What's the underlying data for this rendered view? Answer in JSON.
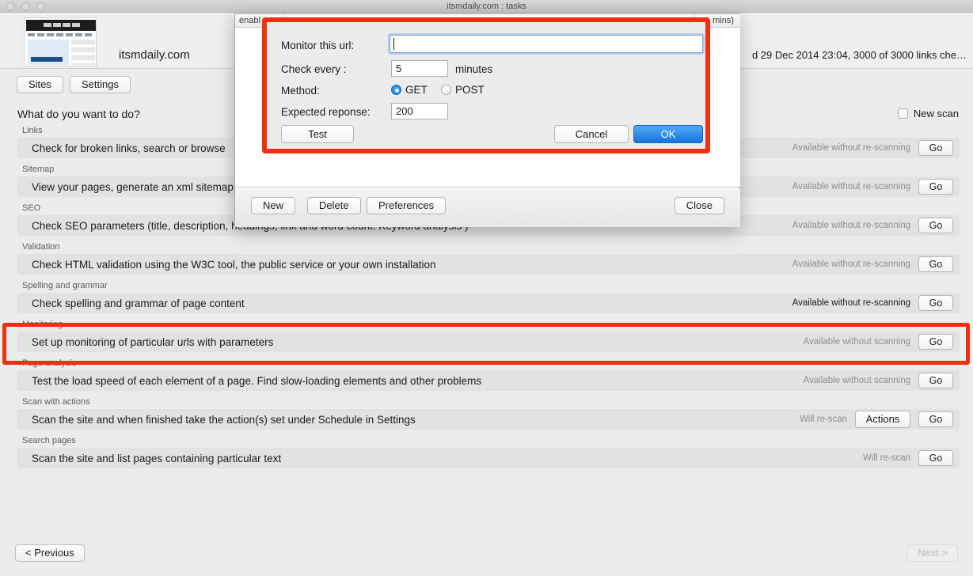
{
  "window": {
    "title": "itsmdaily.com : tasks",
    "traffic_lights": [
      "close",
      "minimize",
      "zoom"
    ]
  },
  "site_header": {
    "site_name": "itsmdaily.com",
    "scan_status": "d 29 Dec 2014 23:04, 3000 of 3000 links che…"
  },
  "tabs": [
    {
      "id": "sites",
      "label": "Sites"
    },
    {
      "id": "settings",
      "label": "Settings"
    }
  ],
  "main": {
    "question": "What do you want to do?",
    "new_scan": {
      "label": "New scan",
      "checked": false
    },
    "previous_button": "< Previous",
    "next_button": "Next >"
  },
  "tasks": [
    {
      "group": "Links",
      "description": "Check for broken links, search or browse",
      "availability": "Available without re-scanning",
      "availability_strong": false,
      "actions_label": null,
      "go_label": "Go"
    },
    {
      "group": "Sitemap",
      "description": "View your pages, generate an xml sitemap",
      "availability": "Available without re-scanning",
      "availability_strong": false,
      "actions_label": null,
      "go_label": "Go"
    },
    {
      "group": "SEO",
      "description": "Check SEO parameters (title, description, headings, link and word count. Keyword analysis )",
      "availability": "Available without re-scanning",
      "availability_strong": false,
      "actions_label": null,
      "go_label": "Go"
    },
    {
      "group": "Validation",
      "description": "Check HTML validation using the W3C tool, the public service or your own installation",
      "availability": "Available without re-scanning",
      "availability_strong": false,
      "actions_label": null,
      "go_label": "Go"
    },
    {
      "group": "Spelling and grammar",
      "description": "Check spelling and grammar of page content",
      "availability": "Available without re-scanning",
      "availability_strong": true,
      "actions_label": null,
      "go_label": "Go"
    },
    {
      "group": "Monitoring",
      "description": "Set up monitoring of particular urls with parameters",
      "availability": "Available without scanning",
      "availability_strong": false,
      "actions_label": null,
      "go_label": "Go",
      "highlighted": true
    },
    {
      "group": "Page analysis",
      "description": "Test the load speed of each element of a page. Find slow-loading elements and other problems",
      "availability": "Available without scanning",
      "availability_strong": false,
      "actions_label": null,
      "go_label": "Go"
    },
    {
      "group": "Scan with actions",
      "description": "Scan the site and when finished take the action(s) set under Schedule in Settings",
      "availability": "Will re-scan",
      "availability_strong": false,
      "actions_label": "Actions",
      "go_label": "Go"
    },
    {
      "group": "Search pages",
      "description": "Scan the site and list pages containing particular text",
      "availability": "Will re-scan",
      "availability_strong": false,
      "actions_label": null,
      "go_label": "Go"
    }
  ],
  "monitor_window": {
    "column_enabled": "enabl",
    "column_mins": "mins)",
    "buttons": {
      "new": "New",
      "delete": "Delete",
      "preferences": "Preferences",
      "close": "Close"
    }
  },
  "url_dialog": {
    "labels": {
      "url": "Monitor this url:",
      "check_every": "Check every :",
      "method": "Method:",
      "expected_response": "Expected reponse:",
      "minutes": "minutes"
    },
    "url_value": "",
    "url_placeholder": "",
    "check_every_value": "5",
    "expected_response_value": "200",
    "method_selected": "GET",
    "method_options": [
      {
        "id": "get",
        "label": "GET",
        "selected": true
      },
      {
        "id": "post",
        "label": "POST",
        "selected": false
      }
    ],
    "buttons": {
      "test": "Test",
      "cancel": "Cancel",
      "ok": "OK"
    }
  },
  "colors": {
    "highlight_red": "#f03010",
    "accent_blue": "#1874dd",
    "row_gray": "#e2e2e2",
    "window_gray": "#ececec"
  }
}
